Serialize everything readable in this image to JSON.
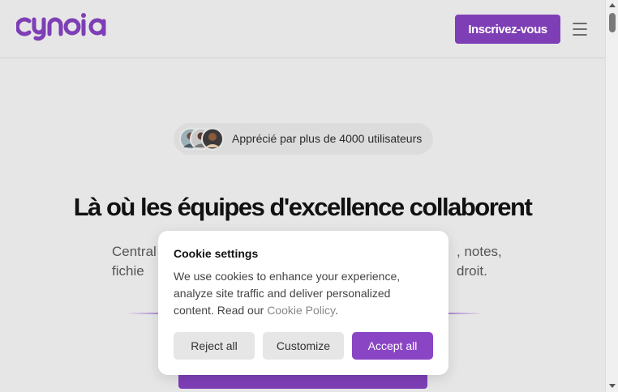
{
  "brand": {
    "logo_text": "cynoia",
    "accent_color": "#7e3fb6"
  },
  "header": {
    "signup_label": "Inscrivez-vous",
    "menu_icon": "hamburger-menu-icon"
  },
  "hero": {
    "badge_text": "Apprécié par plus de 4000 utilisateurs",
    "headline": "Là où les équipes d'excellence collaborent",
    "subtitle_left_line1": "Central",
    "subtitle_left_line2": "fichie",
    "subtitle_right_line1": ", notes,",
    "subtitle_right_line2": "droit."
  },
  "cookie": {
    "title": "Cookie settings",
    "text_before_link": "We use cookies to enhance your experience, analyze site traffic and deliver personalized content. Read our ",
    "link_label": "Cookie Policy",
    "text_after_link": ".",
    "reject_label": "Reject all",
    "customize_label": "Customize",
    "accept_label": "Accept all"
  }
}
